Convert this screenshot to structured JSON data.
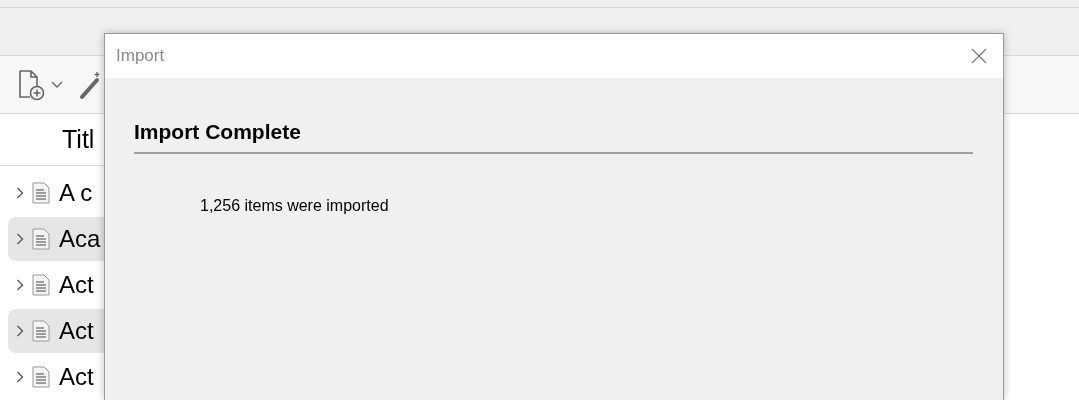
{
  "list": {
    "column_header": "Titl",
    "rows": [
      {
        "title": "A c",
        "highlighted": false
      },
      {
        "title": "Aca",
        "highlighted": true
      },
      {
        "title": "Act",
        "highlighted": false
      },
      {
        "title": "Act",
        "highlighted": true
      },
      {
        "title": "Act",
        "highlighted": false
      }
    ]
  },
  "dialog": {
    "title": "Import",
    "heading": "Import Complete",
    "message": "1,256 items were imported"
  }
}
